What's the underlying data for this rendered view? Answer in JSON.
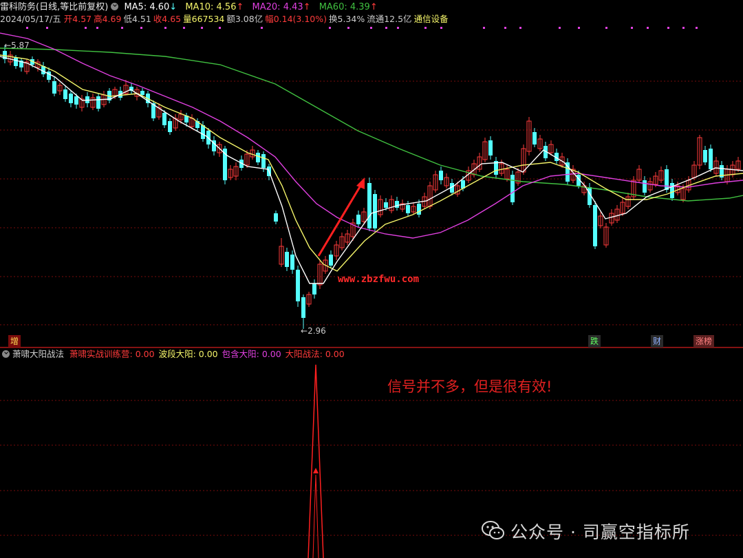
{
  "header": {
    "stock_name": "雷科防务",
    "period": "(日线,等比前复权)",
    "ma5_label": "MA5:",
    "ma5_value": "4.60",
    "ma5_arrow": "↓",
    "ma10_label": "MA10:",
    "ma10_value": "4.56",
    "ma10_arrow": "↑",
    "ma20_label": "MA20:",
    "ma20_value": "4.43",
    "ma20_arrow": "↑",
    "ma60_label": "MA60:",
    "ma60_value": "4.39",
    "ma60_arrow": "↑"
  },
  "quote": {
    "date": "2024/05/17/五",
    "open": "开4.57",
    "high": "高4.69",
    "low": "低4.51",
    "close": "收4.65",
    "volume": "量667534",
    "amount": "额3.08亿",
    "change": "幅0.14(3.10%)",
    "turnover": "换5.34%",
    "float": "流通12.5亿",
    "sector": "通信设备"
  },
  "price_labels": {
    "high_mark": "5.87",
    "low_mark": "2.96"
  },
  "website": "www.zbzfwu.com",
  "tags": {
    "zeng": "增",
    "die": "跌",
    "cai": "财",
    "zhangbang": "涨榜"
  },
  "indicator": {
    "name": "萧啸大阳战法",
    "line1_label": "萧啸实战训练营:",
    "line1_value": "0.00",
    "line2_label": "波段大阳:",
    "line2_value": "0.00",
    "line3_label": "包含大阳:",
    "line3_value": "0.00",
    "line4_label": "大阳战法:",
    "line4_value": "0.00"
  },
  "annotation": "信号并不多，但是很有效!",
  "watermark": "公众号 · 司赢空指标所",
  "colors": {
    "up": "#ff3b3b",
    "down": "#54ffff",
    "ma5": "#ffffff",
    "ma10": "#f5f56a",
    "ma20": "#e040e0",
    "ma60": "#40c040",
    "grid": "#7a0c0c"
  }
}
